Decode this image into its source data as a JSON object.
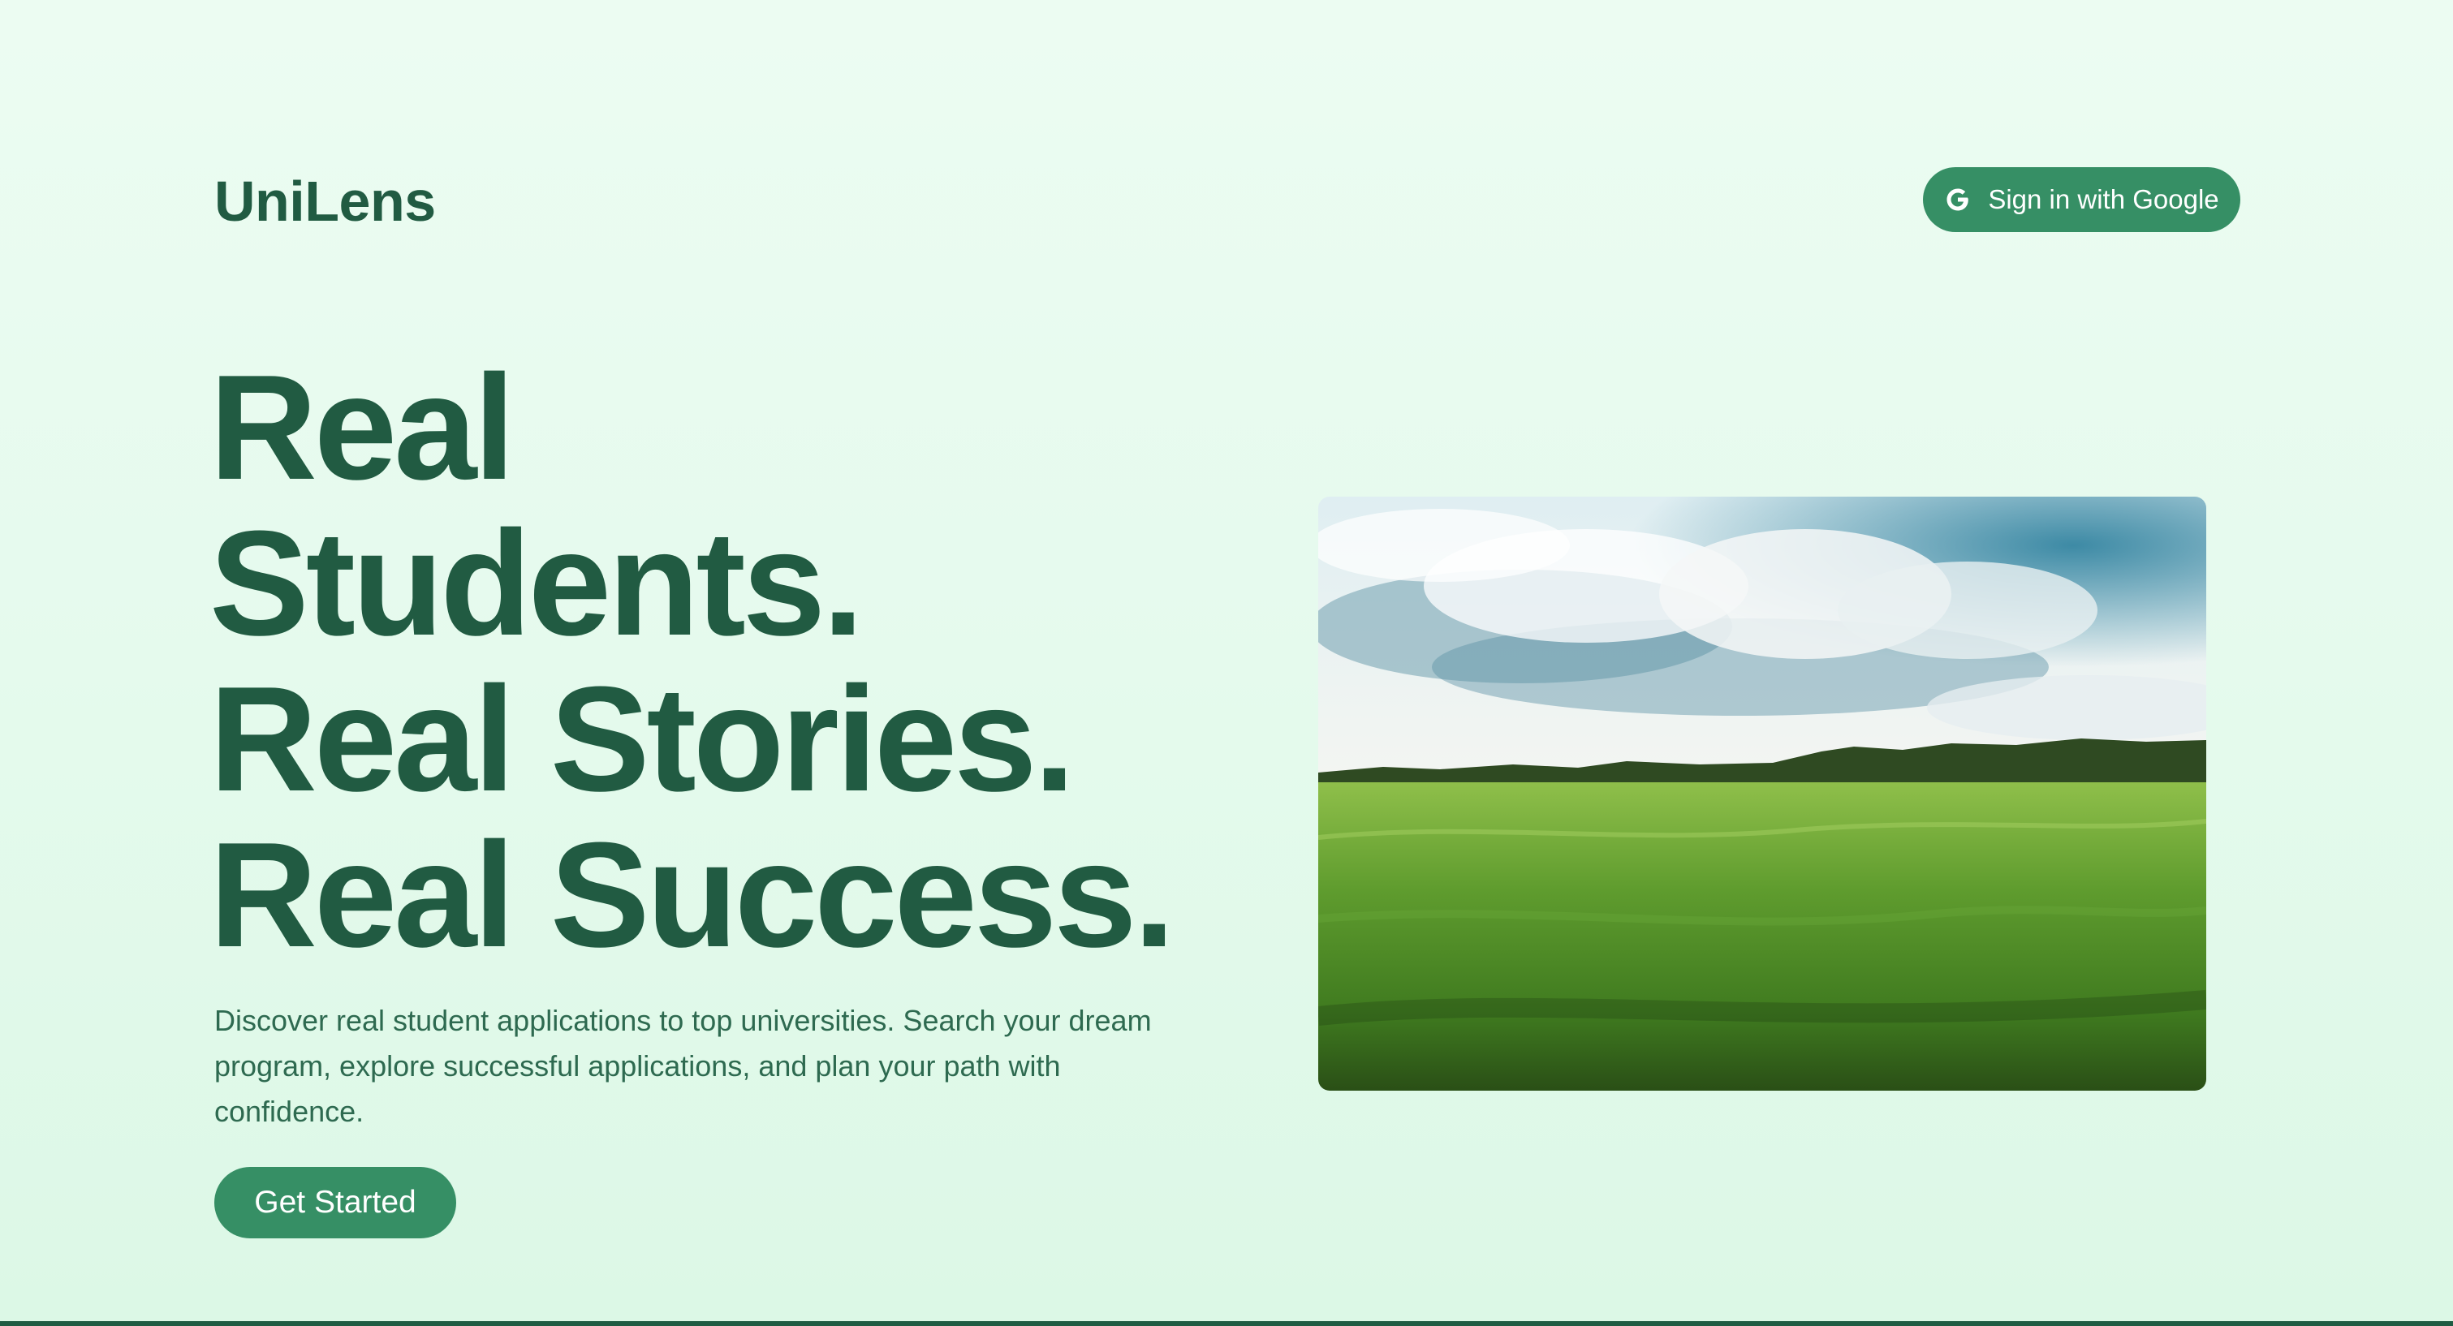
{
  "header": {
    "brand": "UniLens",
    "signin_label": "Sign in with Google",
    "signin_icon": "google-g-icon"
  },
  "hero": {
    "headline": [
      "Real",
      "Students.",
      "Real Stories.",
      "Real Success."
    ],
    "description": "Discover real student applications to top universities. Search your dream program, explore successful applications, and plan your path with confidence.",
    "cta_label": "Get Started",
    "image_subject": "green wheat field under cloudy sky"
  },
  "colors": {
    "brand_green": "#215b42",
    "button_green": "#368f65",
    "background": "#e6faee"
  }
}
